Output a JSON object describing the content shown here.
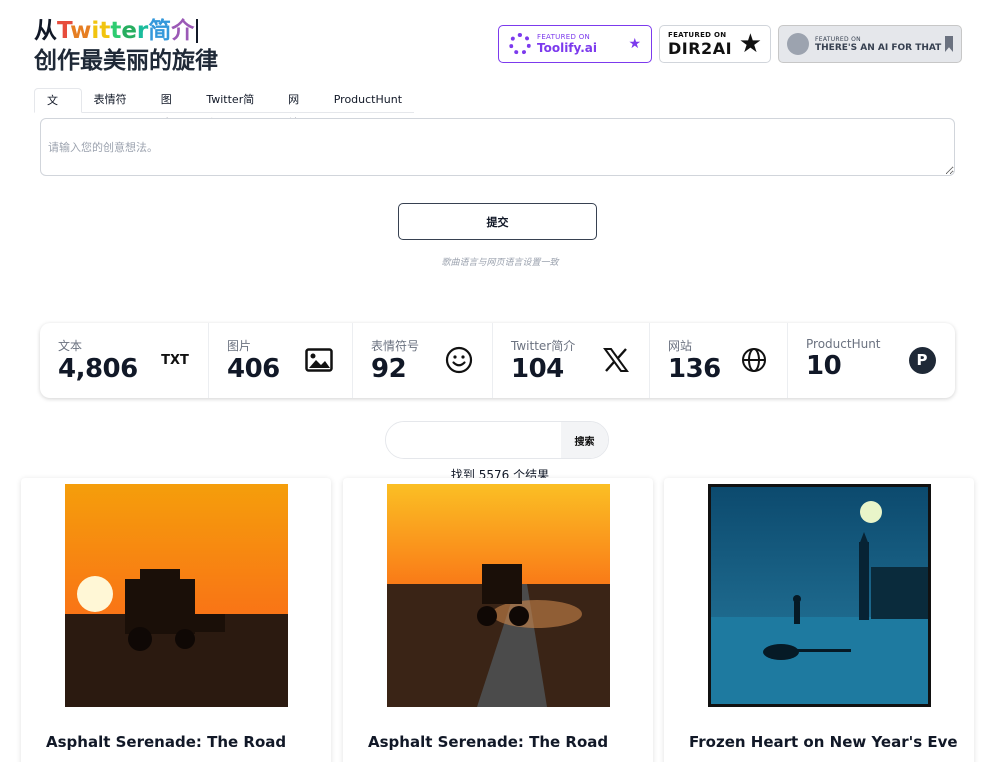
{
  "header": {
    "title_prefix": "从",
    "title_word": [
      "T",
      "w",
      "i",
      "t",
      "t",
      "e",
      "r",
      "简",
      "介"
    ],
    "title_colors": [
      "#e74c3c",
      "#e67e22",
      "#f1c40f",
      "#f1c40f",
      "#2ecc71",
      "#27ae60",
      "#1abc9c",
      "#3498db",
      "#9b59b6"
    ],
    "subtitle": "创作最美丽的旋律"
  },
  "badges": {
    "toolify": {
      "small": "FEATURED ON",
      "big": "Toolify.ai"
    },
    "dir2ai": {
      "small": "FEATURED ON",
      "big": "DIR2AI"
    },
    "aiforthat": {
      "small": "FEATURED ON",
      "big": "THERE'S AN AI FOR THAT"
    }
  },
  "tabs": [
    "文本",
    "表情符号",
    "图片",
    "Twitter简介",
    "网站",
    "ProductHunt"
  ],
  "input": {
    "placeholder": "请输入您的创意想法。"
  },
  "submit_label": "提交",
  "hint": "歌曲语言与网页语言设置一致",
  "stats": [
    {
      "label": "文本",
      "value": "4,806",
      "icon": "txt-icon",
      "icon_text": "TXT"
    },
    {
      "label": "图片",
      "value": "406",
      "icon": "image-icon"
    },
    {
      "label": "表情符号",
      "value": "92",
      "icon": "smiley-icon"
    },
    {
      "label": "Twitter简介",
      "value": "104",
      "icon": "x-logo-icon"
    },
    {
      "label": "网站",
      "value": "136",
      "icon": "globe-icon"
    },
    {
      "label": "ProductHunt",
      "value": "10",
      "icon": "producthunt-icon",
      "icon_text": "P"
    }
  ],
  "search": {
    "button": "搜索",
    "placeholder": ""
  },
  "result_count": "找到 5576 个结果",
  "cards": [
    {
      "title": "Asphalt Serenade: The Road"
    },
    {
      "title": "Asphalt Serenade: The Road"
    },
    {
      "title": "Frozen Heart on New Year's Eve"
    }
  ]
}
